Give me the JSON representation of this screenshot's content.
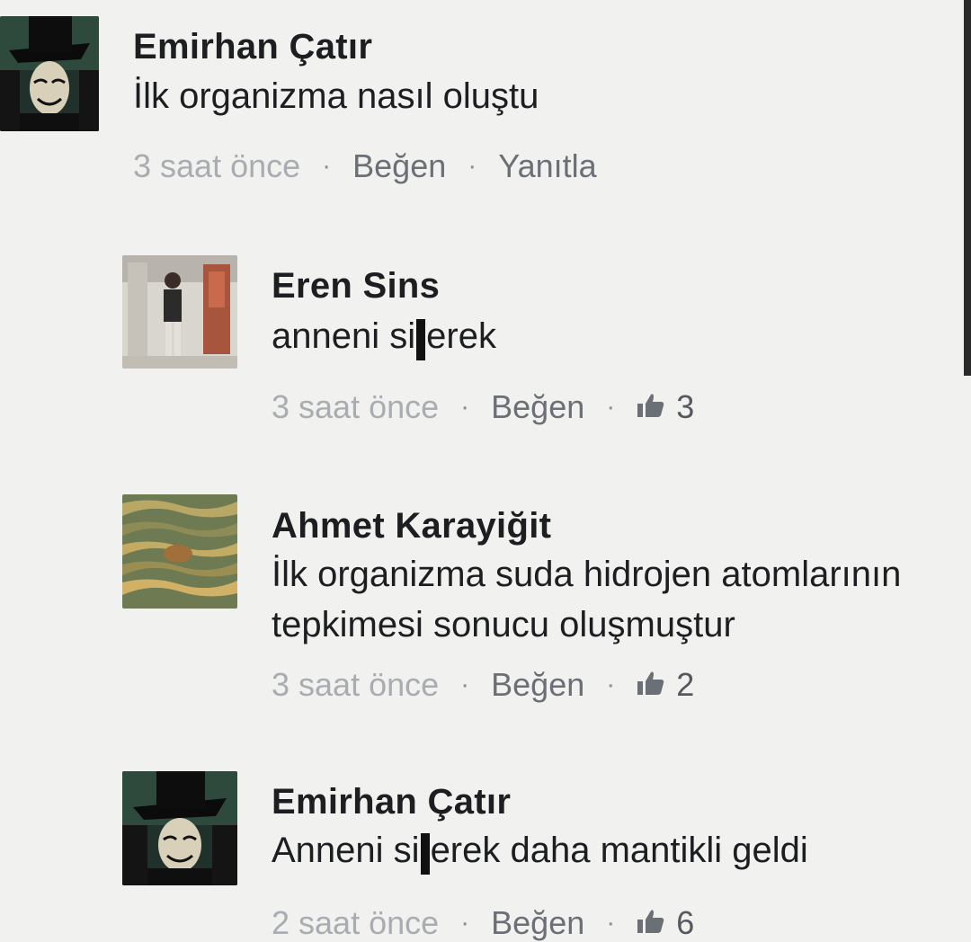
{
  "comments": [
    {
      "author": "Emirhan Çatır",
      "avatar_icon": "masked-figure-avatar",
      "text_lines": [
        "İlk organizma nasıl oluştu"
      ],
      "time": "3 saat önce",
      "like_label": "Beğen",
      "reply_label": "Yanıtla"
    },
    {
      "author": "Eren Sins",
      "avatar_icon": "person-photo-avatar",
      "text_before": "anneni si",
      "text_after": "erek",
      "time": "3 saat önce",
      "like_label": "Beğen",
      "like_count": "3"
    },
    {
      "author": "Ahmet Karayiğit",
      "avatar_icon": "water-texture-avatar",
      "text_lines": [
        "İlk organizma suda hidrojen atomlarının",
        "tepkimesi sonucu oluşmuştur"
      ],
      "time": "3 saat önce",
      "like_label": "Beğen",
      "like_count": "2"
    },
    {
      "author": "Emirhan Çatır",
      "avatar_icon": "masked-figure-avatar",
      "text_before": "Anneni si",
      "text_after": "erek daha mantikli geldi",
      "time": "2 saat önce",
      "like_label": "Beğen",
      "like_count": "6"
    }
  ],
  "separator": "·",
  "colors": {
    "background": "#f1f1ef",
    "name": "#1c1e21",
    "meta": "#6b6f76",
    "time": "#a9acb1"
  }
}
